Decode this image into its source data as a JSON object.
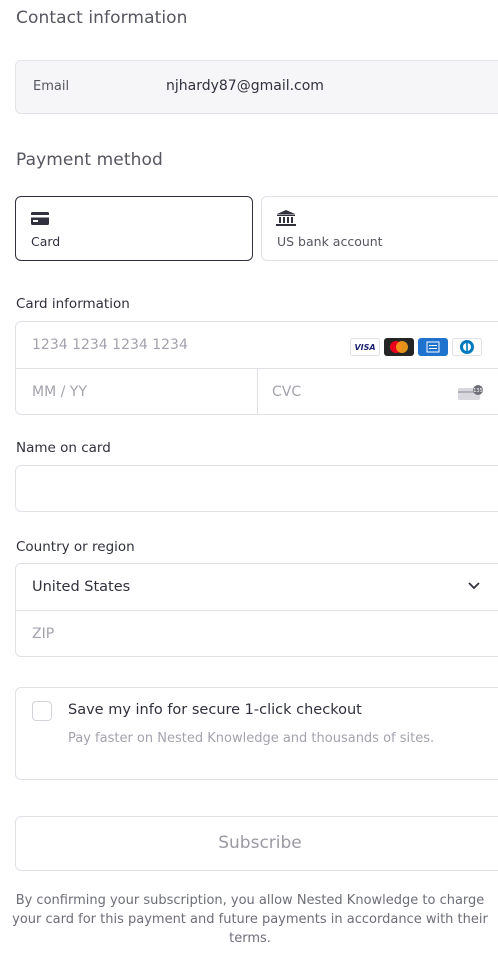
{
  "contact": {
    "title": "Contact information",
    "email_label": "Email",
    "email_value": "njhardy87@gmail.com"
  },
  "payment": {
    "title": "Payment method",
    "tabs": [
      {
        "label": "Card",
        "icon": "credit-card-icon",
        "active": true
      },
      {
        "label": "US bank account",
        "icon": "bank-icon",
        "active": false
      }
    ]
  },
  "card": {
    "label": "Card information",
    "number_placeholder": "1234 1234 1234 1234",
    "expiry_placeholder": "MM / YY",
    "cvc_placeholder": "CVC",
    "brands": [
      "VISA",
      "Mastercard",
      "AMEX",
      "Diners"
    ]
  },
  "name": {
    "label": "Name on card",
    "value": ""
  },
  "country": {
    "label": "Country or region",
    "selected": "United States",
    "zip_placeholder": "ZIP"
  },
  "save": {
    "title": "Save my info for secure 1-click checkout",
    "subtitle": "Pay faster on Nested Knowledge and thousands of sites.",
    "checked": false
  },
  "subscribe_label": "Subscribe",
  "terms": "By confirming your subscription, you allow Nested Knowledge to charge your card for this payment and future payments in accordance with their terms."
}
